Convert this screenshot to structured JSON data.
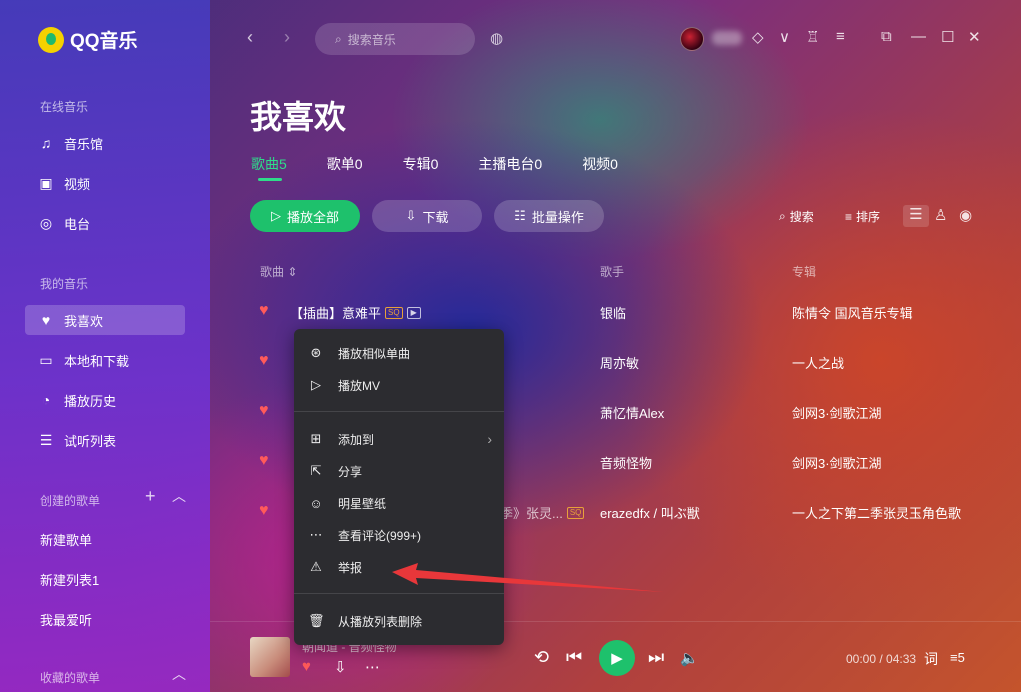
{
  "app": {
    "name": "QQ音乐"
  },
  "sidebar": {
    "online_section": "在线音乐",
    "online_items": [
      {
        "label": "音乐馆",
        "icon": "music-note-icon"
      },
      {
        "label": "视频",
        "icon": "video-icon"
      },
      {
        "label": "电台",
        "icon": "radio-icon"
      }
    ],
    "my_section": "我的音乐",
    "my_items": [
      {
        "label": "我喜欢",
        "icon": "heart-icon",
        "active": true
      },
      {
        "label": "本地和下载",
        "icon": "monitor-icon"
      },
      {
        "label": "播放历史",
        "icon": "clock-icon"
      },
      {
        "label": "试听列表",
        "icon": "playlist-icon"
      }
    ],
    "created_section": "创建的歌单",
    "created_items": [
      "新建歌单",
      "新建列表1",
      "我最爱听"
    ],
    "collected_section": "收藏的歌单"
  },
  "topbar": {
    "search_placeholder": "搜索音乐"
  },
  "page": {
    "title": "我喜欢",
    "tabs": [
      "歌曲5",
      "歌单0",
      "专辑0",
      "主播电台0",
      "视频0"
    ],
    "active_tab": 0,
    "buttons": {
      "play_all": "播放全部",
      "download": "下载",
      "batch": "批量操作"
    },
    "tools": {
      "search": "搜索",
      "sort": "排序"
    }
  },
  "table": {
    "headers": {
      "song": "歌曲",
      "singer": "歌手",
      "album": "专辑"
    },
    "rows": [
      {
        "song": "【插曲】意难平",
        "sq": "SQ",
        "mv": true,
        "singer": "银临",
        "album": "陈情令 国风音乐专辑"
      },
      {
        "song": "",
        "sq": "",
        "mv": false,
        "singer": "周亦敏",
        "album": "一人之战"
      },
      {
        "song": "",
        "sq": "",
        "mv": false,
        "singer": "萧忆情Alex",
        "album": "剑网3·剑歌江湖"
      },
      {
        "song": "",
        "sq": "",
        "mv": false,
        "singer": "音频怪物",
        "album": "剑网3·剑歌江湖"
      },
      {
        "song": "季》张灵...",
        "sq": "SQ",
        "mv": false,
        "singer": "erazedfx / 叫ぶ獣",
        "album": "一人之下第二季张灵玉角色歌"
      }
    ]
  },
  "context_menu": {
    "items": [
      {
        "label": "播放相似单曲",
        "icon": "radar-icon"
      },
      {
        "label": "播放MV",
        "icon": "mv-icon"
      },
      {
        "label": "添加到",
        "icon": "plus-box-icon",
        "submenu": true
      },
      {
        "label": "分享",
        "icon": "share-icon"
      },
      {
        "label": "明星壁纸",
        "icon": "portrait-icon"
      },
      {
        "label": "查看评论(999+)",
        "icon": "comment-icon"
      },
      {
        "label": "举报",
        "icon": "warning-icon"
      },
      {
        "label": "从播放列表删除",
        "icon": "trash-icon"
      }
    ]
  },
  "player": {
    "now_playing": "朝闻道 - 音频怪物",
    "time": "00:00 / 04:33",
    "lyrics_label": "词",
    "queue_count": "5"
  },
  "colors": {
    "accent": "#1ec16c",
    "heart": "#ff5a5a",
    "annotation_arrow": "#e8373a"
  }
}
